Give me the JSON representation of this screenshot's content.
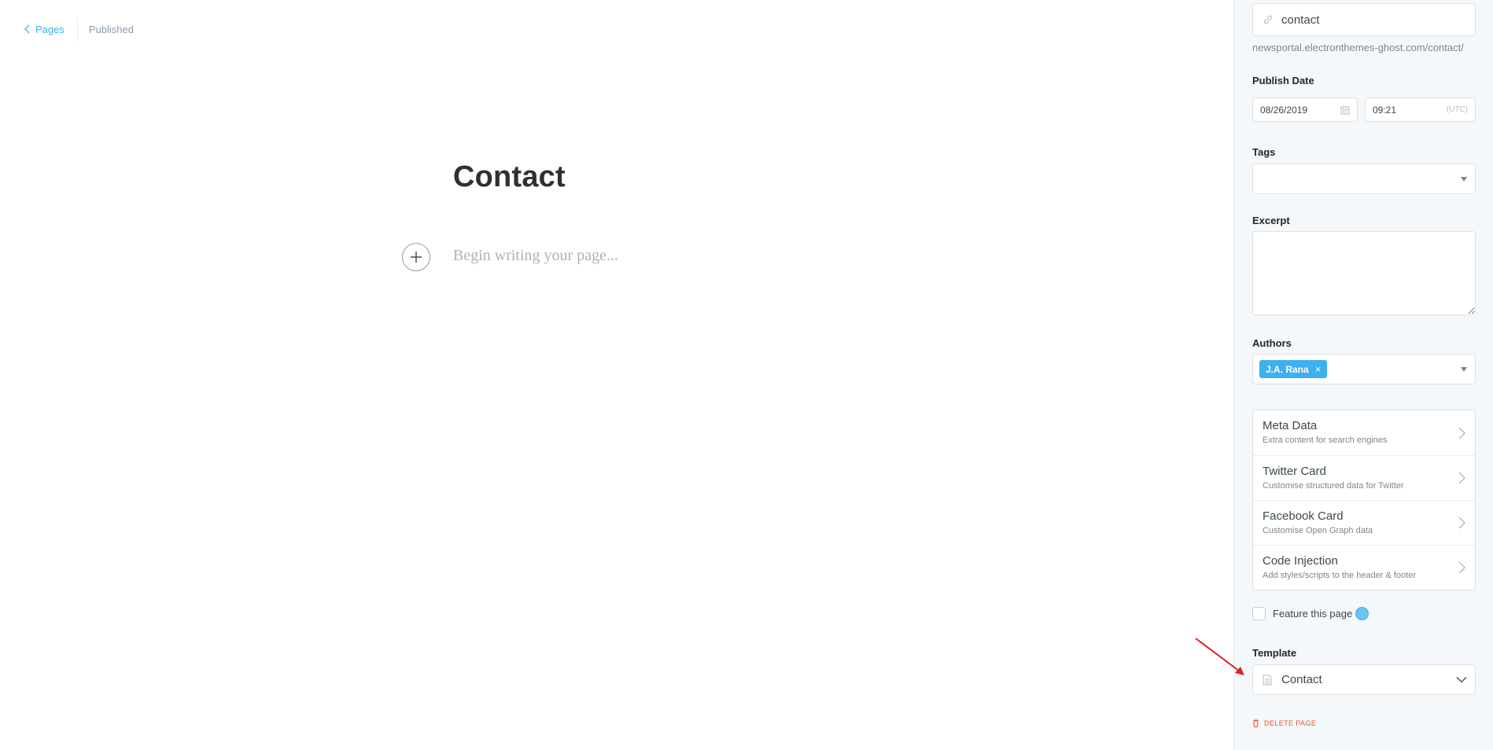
{
  "header": {
    "back_label": "Pages",
    "status": "Published"
  },
  "editor": {
    "title": "Contact",
    "body_placeholder": "Begin writing your page..."
  },
  "sidebar": {
    "url": {
      "value": "contact",
      "preview": "newsportal.electronthemes-ghost.com/contact/"
    },
    "publish_date": {
      "label": "Publish Date",
      "date": "08/26/2019",
      "time": "09:21",
      "timezone": "(UTC)"
    },
    "tags": {
      "label": "Tags"
    },
    "excerpt": {
      "label": "Excerpt",
      "value": ""
    },
    "authors": {
      "label": "Authors",
      "selected": [
        "J.A. Rana"
      ]
    },
    "menu": [
      {
        "title": "Meta Data",
        "desc": "Extra content for search engines"
      },
      {
        "title": "Twitter Card",
        "desc": "Customise structured data for Twitter"
      },
      {
        "title": "Facebook Card",
        "desc": "Customise Open Graph data"
      },
      {
        "title": "Code Injection",
        "desc": "Add styles/scripts to the header & footer"
      }
    ],
    "feature": {
      "label": "Feature this page",
      "checked": false
    },
    "template": {
      "label": "Template",
      "value": "Contact"
    },
    "delete_label": "DELETE PAGE"
  },
  "colors": {
    "accent": "#3eb0ef",
    "danger": "#f05230",
    "annotation": "#e02020",
    "sidebar_bg": "#f4f8fb"
  }
}
